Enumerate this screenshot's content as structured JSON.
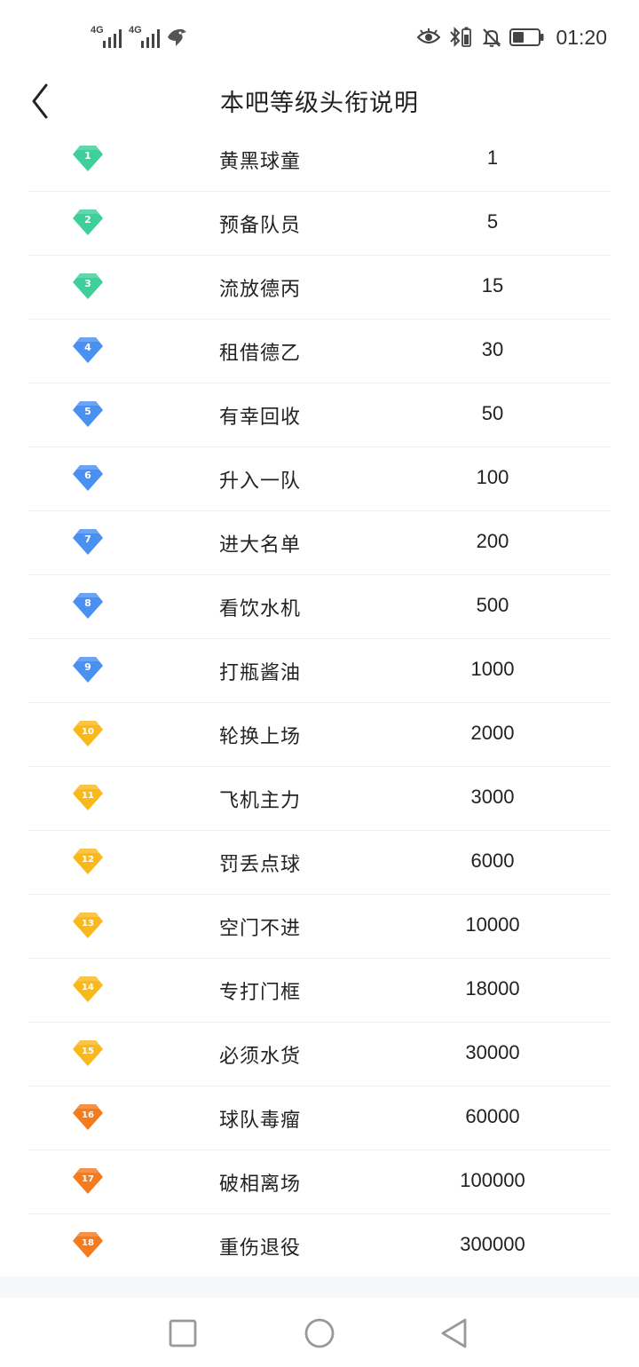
{
  "status": {
    "network1": "4G",
    "network2": "4G",
    "time": "01:20"
  },
  "header": {
    "title": "本吧等级头衔说明"
  },
  "levels": [
    {
      "level": "1",
      "name": "黄黑球童",
      "points": "1",
      "color": "#3ecf9a"
    },
    {
      "level": "2",
      "name": "预备队员",
      "points": "5",
      "color": "#3ecf9a"
    },
    {
      "level": "3",
      "name": "流放德丙",
      "points": "15",
      "color": "#3ecf9a"
    },
    {
      "level": "4",
      "name": "租借德乙",
      "points": "30",
      "color": "#4a90f0"
    },
    {
      "level": "5",
      "name": "有幸回收",
      "points": "50",
      "color": "#4a90f0"
    },
    {
      "level": "6",
      "name": "升入一队",
      "points": "100",
      "color": "#4a90f0"
    },
    {
      "level": "7",
      "name": "进大名单",
      "points": "200",
      "color": "#4a90f0"
    },
    {
      "level": "8",
      "name": "看饮水机",
      "points": "500",
      "color": "#4a90f0"
    },
    {
      "level": "9",
      "name": "打瓶酱油",
      "points": "1000",
      "color": "#4a90f0"
    },
    {
      "level": "10",
      "name": "轮换上场",
      "points": "2000",
      "color": "#f9b81c"
    },
    {
      "level": "11",
      "name": "飞机主力",
      "points": "3000",
      "color": "#f9b81c"
    },
    {
      "level": "12",
      "name": "罚丢点球",
      "points": "6000",
      "color": "#f9b81c"
    },
    {
      "level": "13",
      "name": "空门不进",
      "points": "10000",
      "color": "#f9b81c"
    },
    {
      "level": "14",
      "name": "专打门框",
      "points": "18000",
      "color": "#f9b81c"
    },
    {
      "level": "15",
      "name": "必须水货",
      "points": "30000",
      "color": "#f9b81c"
    },
    {
      "level": "16",
      "name": "球队毒瘤",
      "points": "60000",
      "color": "#f57b1f"
    },
    {
      "level": "17",
      "name": "破相离场",
      "points": "100000",
      "color": "#f57b1f"
    },
    {
      "level": "18",
      "name": "重伤退役",
      "points": "300000",
      "color": "#f57b1f"
    }
  ]
}
